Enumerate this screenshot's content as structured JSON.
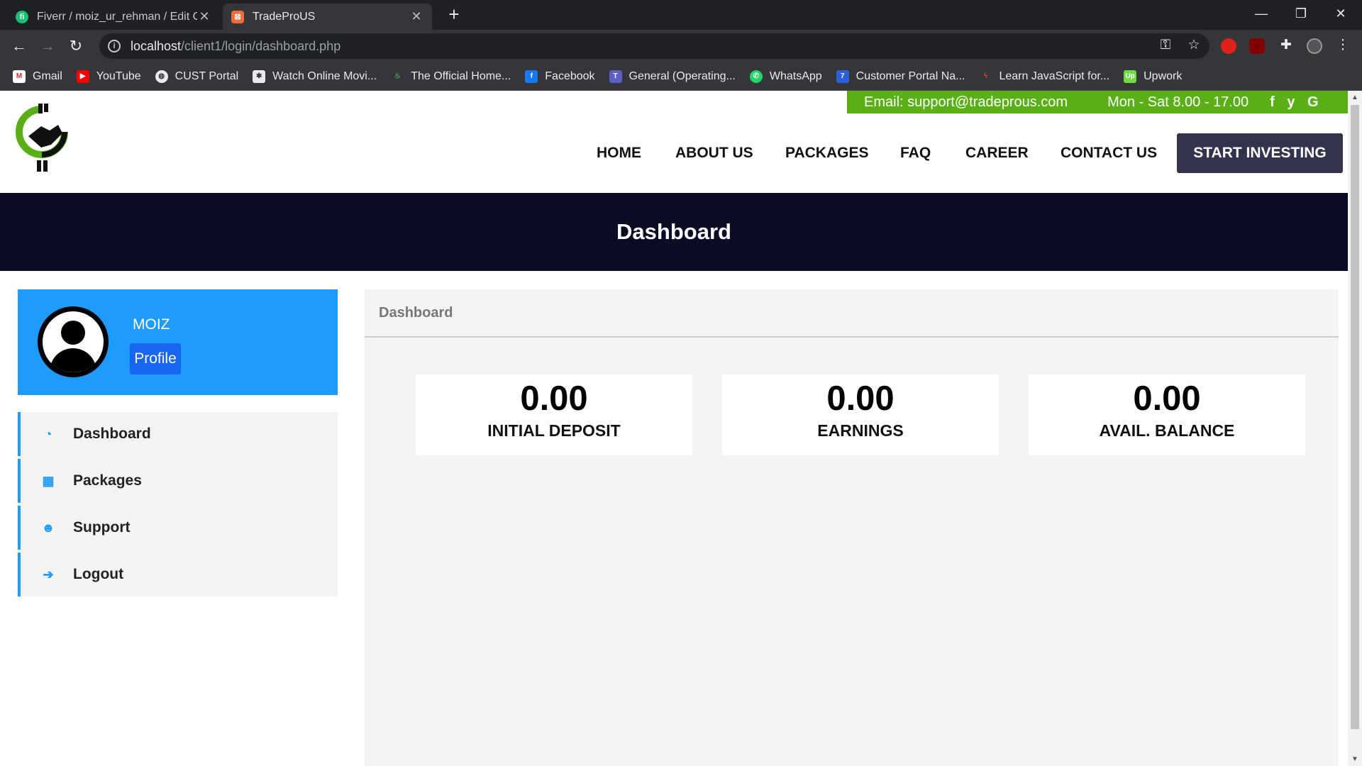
{
  "browser": {
    "tabs": [
      {
        "title": "Fiverr / moiz_ur_rehman / Edit Gi",
        "active": false
      },
      {
        "title": "TradeProUS",
        "active": true
      }
    ],
    "address": {
      "host": "localhost",
      "path": "/client1/login/dashboard.php"
    },
    "bookmarks": [
      "Gmail",
      "YouTube",
      "CUST Portal",
      "Watch Online Movi...",
      "The Official Home...",
      "Facebook",
      "General (Operating...",
      "WhatsApp",
      "Customer Portal Na...",
      "Learn JavaScript for...",
      "Upwork"
    ]
  },
  "site": {
    "topbar": {
      "email": "Email: support@tradeprous.com",
      "hours": "Mon - Sat 8.00 - 17.00",
      "social": "f y G"
    },
    "nav": [
      "HOME",
      "ABOUT US",
      "PACKAGES",
      "FAQ",
      "CAREER",
      "CONTACT US"
    ],
    "cta": "START INVESTING",
    "banner_title": "Dashboard"
  },
  "sidebar": {
    "username": "MOIZ",
    "profile_button": "Profile",
    "menu": [
      {
        "label": "Dashboard",
        "icon": "dashboard-icon"
      },
      {
        "label": "Packages",
        "icon": "grid-icon"
      },
      {
        "label": "Support",
        "icon": "users-icon"
      },
      {
        "label": "Logout",
        "icon": "logout-icon"
      }
    ]
  },
  "content": {
    "heading": "Dashboard",
    "stats": [
      {
        "value": "0.00",
        "label": "INITIAL DEPOSIT"
      },
      {
        "value": "0.00",
        "label": "EARNINGS"
      },
      {
        "value": "0.00",
        "label": "AVAIL. BALANCE"
      }
    ]
  },
  "colors": {
    "accent": "#1e9bff",
    "topbar": "#5aae16",
    "banner": "#0a0b25",
    "cta": "#33334d"
  }
}
